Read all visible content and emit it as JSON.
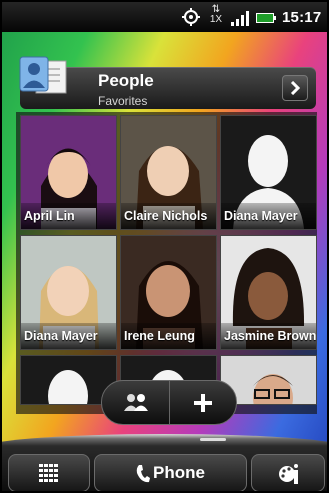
{
  "status_bar": {
    "icons": [
      "gps-icon",
      "network-1x-icon",
      "signal-icon",
      "battery-icon"
    ],
    "network_label": "1X",
    "time": "15:17"
  },
  "widget": {
    "title": "People",
    "subtitle": "Favorites",
    "contacts": [
      {
        "name": "April Lin"
      },
      {
        "name": "Claire Nichols"
      },
      {
        "name": "Diana Mayer"
      },
      {
        "name": "Diana Mayer"
      },
      {
        "name": "Irene Leung"
      },
      {
        "name": "Jasmine Brown"
      },
      {
        "name": ""
      },
      {
        "name": ""
      },
      {
        "name": ""
      }
    ]
  },
  "controls": {
    "groups_icon": "group-icon",
    "add_icon": "plus-icon"
  },
  "dock": {
    "apps_icon": "all-apps-grid-icon",
    "phone_label": "Phone",
    "personalize_icon": "personalize-icon"
  }
}
